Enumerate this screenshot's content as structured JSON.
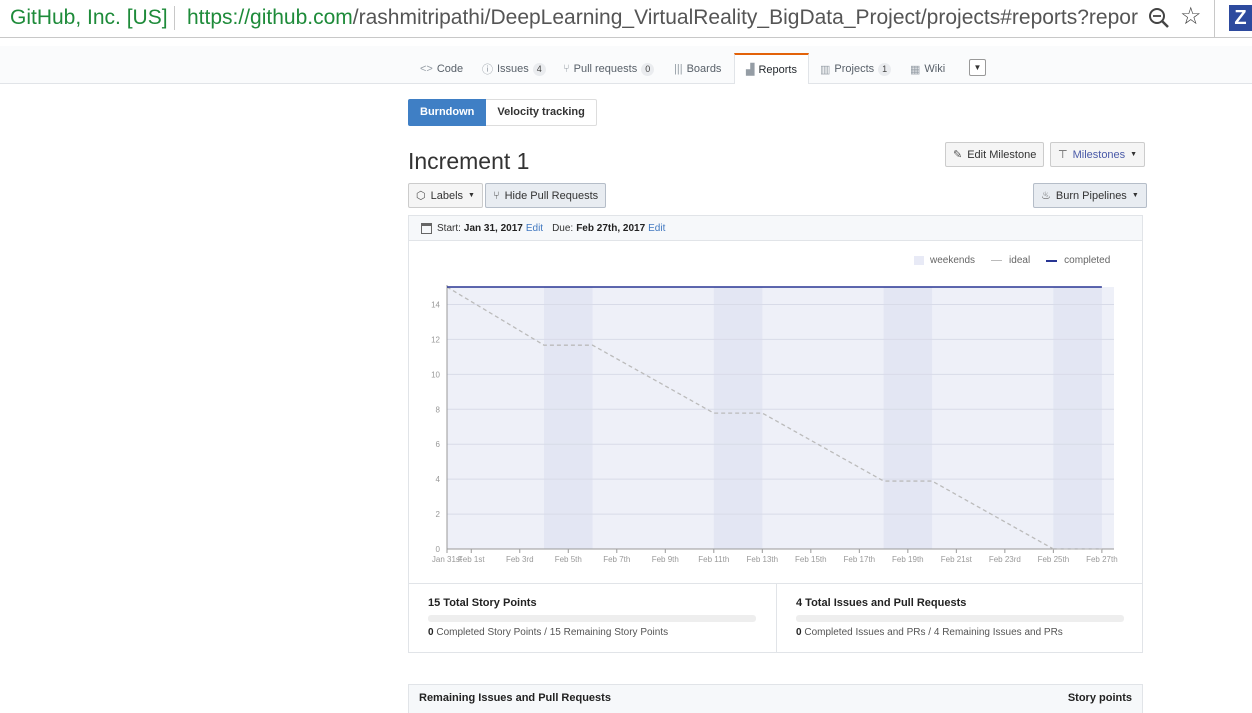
{
  "browser": {
    "identity": "GitHub, Inc. [US]",
    "url_scheme": "https://",
    "url_domain": "github.com",
    "url_path": "/rashmitripathi/DeepLearning_VirtualReality_BigData_Project/projects#reports?repor",
    "extension_label": "Z"
  },
  "nav": {
    "code": "Code",
    "issues": "Issues",
    "issues_count": "4",
    "pulls": "Pull requests",
    "pulls_count": "0",
    "boards": "Boards",
    "reports": "Reports",
    "projects": "Projects",
    "projects_count": "1",
    "wiki": "Wiki"
  },
  "tabs": {
    "burndown": "Burndown",
    "velocity": "Velocity tracking"
  },
  "milestone": {
    "title": "Increment 1",
    "edit_button": "Edit Milestone",
    "milestones_button": "Milestones",
    "labels_button": "Labels",
    "hide_prs_button": "Hide Pull Requests",
    "burn_pipelines_button": "Burn Pipelines",
    "start_label": "Start:",
    "start_date": "Jan 31, 2017",
    "start_edit": "Edit",
    "due_label": "Due:",
    "due_date": "Feb 27th, 2017",
    "due_edit": "Edit"
  },
  "legend": {
    "weekends": "weekends",
    "ideal": "ideal",
    "completed": "completed"
  },
  "chart_data": {
    "type": "line",
    "x_labels": [
      "Jan 31st",
      "Feb 1st",
      "Feb 3rd",
      "Feb 5th",
      "Feb 7th",
      "Feb 9th",
      "Feb 11th",
      "Feb 13th",
      "Feb 15th",
      "Feb 17th",
      "Feb 19th",
      "Feb 21st",
      "Feb 23rd",
      "Feb 25th",
      "Feb 27th"
    ],
    "x_label_days": [
      0,
      1,
      3,
      5,
      7,
      9,
      11,
      13,
      15,
      17,
      19,
      21,
      23,
      25,
      27
    ],
    "y_ticks": [
      0,
      2,
      4,
      6,
      8,
      10,
      12,
      14
    ],
    "ylim": [
      0,
      15
    ],
    "xlim_days": [
      0,
      27.5
    ],
    "weekends_days": [
      [
        4,
        6
      ],
      [
        11,
        13
      ],
      [
        18,
        20
      ],
      [
        25,
        27
      ]
    ],
    "series": [
      {
        "name": "ideal",
        "color": "#bbbbbb",
        "dashed": true,
        "days": [
          0,
          4,
          6,
          11,
          13,
          18,
          20,
          25,
          27
        ],
        "values": [
          15,
          11.67,
          11.67,
          7.78,
          7.78,
          3.89,
          3.89,
          0,
          0
        ]
      },
      {
        "name": "completed",
        "color": "#283593",
        "dashed": false,
        "days": [
          0,
          27
        ],
        "values": [
          15,
          15
        ]
      }
    ],
    "colors": {
      "weekend": "#e3e6f3",
      "background": "#eef0f8",
      "grid": "#d8dbe8"
    }
  },
  "stats": {
    "story_points_title": "15 Total Story Points",
    "story_completed": "0",
    "story_completed_label": "Completed Story Points / 15 Remaining Story Points",
    "story_progress": 0,
    "issues_title": "4 Total Issues and Pull Requests",
    "issues_completed": "0",
    "issues_completed_label": "Completed Issues and PRs / 4 Remaining Issues and PRs",
    "issues_progress": 0
  },
  "remaining": {
    "title": "Remaining Issues and Pull Requests",
    "column": "Story points"
  }
}
